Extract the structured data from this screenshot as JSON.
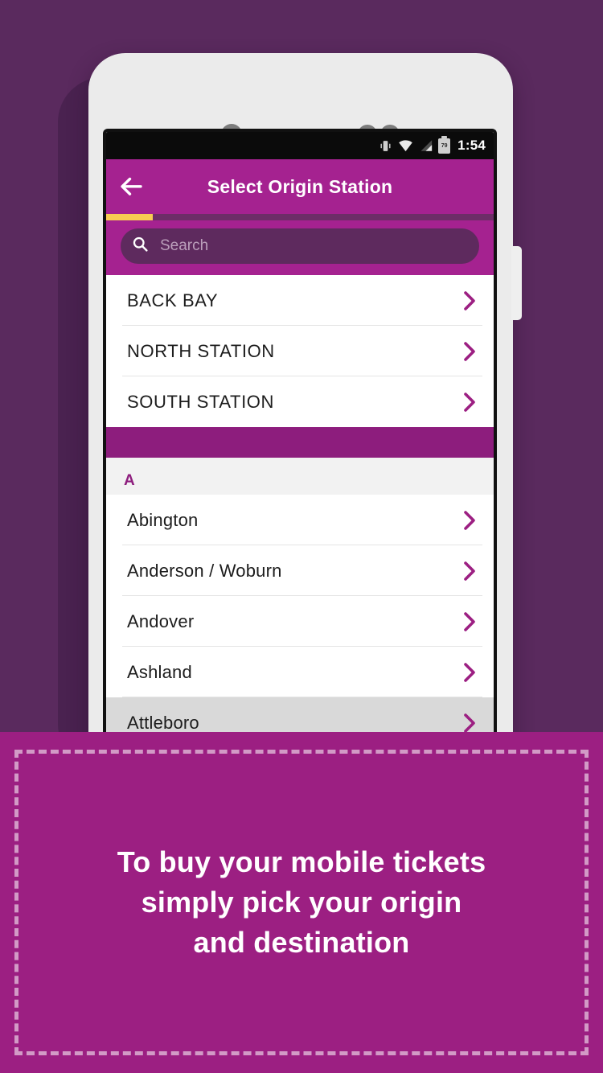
{
  "app": {
    "title": "Select Origin Station",
    "back_icon": "arrow-left-icon",
    "progress_percent": 12,
    "accent_color": "#a52290",
    "progress_color": "#f8cc52",
    "background_color": "#5a2a5e"
  },
  "status_bar": {
    "time": "1:54",
    "battery_level": "79",
    "icons": [
      "vibrate-icon",
      "wifi-icon",
      "signal-icon",
      "battery-icon"
    ]
  },
  "search": {
    "placeholder": "Search",
    "value": "",
    "icon": "search-icon"
  },
  "featured_stations": [
    {
      "name": "BACK BAY",
      "chevron": "chevron-right-icon"
    },
    {
      "name": "NORTH STATION",
      "chevron": "chevron-right-icon"
    },
    {
      "name": "SOUTH STATION",
      "chevron": "chevron-right-icon"
    }
  ],
  "sections": [
    {
      "letter": "A",
      "stations": [
        {
          "name": "Abington",
          "chevron": "chevron-right-icon"
        },
        {
          "name": "Anderson / Woburn",
          "chevron": "chevron-right-icon"
        },
        {
          "name": "Andover",
          "chevron": "chevron-right-icon"
        },
        {
          "name": "Ashland",
          "chevron": "chevron-right-icon"
        },
        {
          "name": "Attleboro",
          "chevron": "chevron-right-icon"
        }
      ]
    }
  ],
  "caption": {
    "line1": "To buy your mobile tickets",
    "line2": "simply pick your origin",
    "line3": "and destination",
    "background_color": "#9c1f82"
  }
}
